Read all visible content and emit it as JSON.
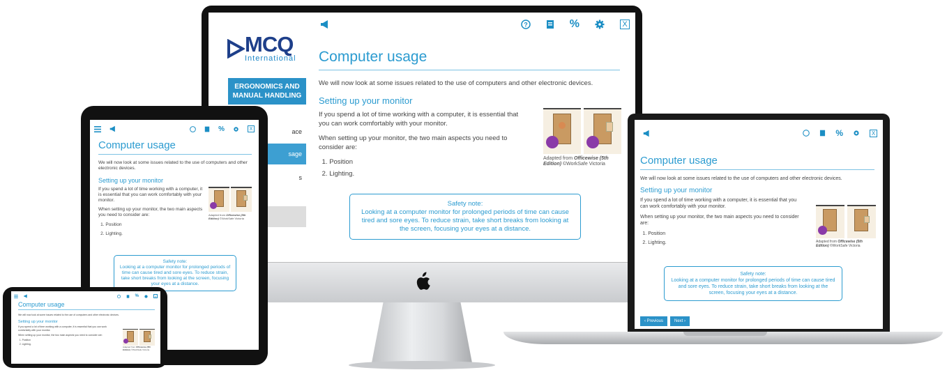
{
  "app": {
    "logo_text": "MCQ",
    "logo_sub": "International",
    "module_button": "ERGONOMICS AND MANUAL HANDLING",
    "nav_items": [
      "ace",
      "sage",
      "s"
    ]
  },
  "icons": [
    "megaphone-icon",
    "help-icon",
    "glossary-icon",
    "percent-icon",
    "settings-icon",
    "close-icon",
    "menu-icon"
  ],
  "accent_color": "#2b9bd0",
  "page": {
    "title": "Computer usage",
    "intro": "We will now look at some issues related to the use of computers and other electronic devices.",
    "subheading": "Setting up your monitor",
    "para1": "If you spend a lot of time working with a computer, it is essential that you can work comfortably with your monitor.",
    "para2": "When setting up your monitor, the two main aspects you need to consider are:",
    "list": [
      "Position",
      "Lighting."
    ],
    "caption_prefix": "Adapted from ",
    "caption_book": "Officewise (5th Edition)",
    "caption_suffix": " ©WorkSafe Victoria",
    "note_title": "Safety note:",
    "note_body": "Looking at a computer monitor for prolonged periods of time can cause tired and sore eyes. To reduce strain, take short breaks from looking at the screen, focusing your eyes at a distance."
  },
  "toolbar": {
    "percent": "%",
    "close": "X"
  },
  "pager": {
    "previous": "‹  Previous",
    "next": "Next  ›"
  }
}
